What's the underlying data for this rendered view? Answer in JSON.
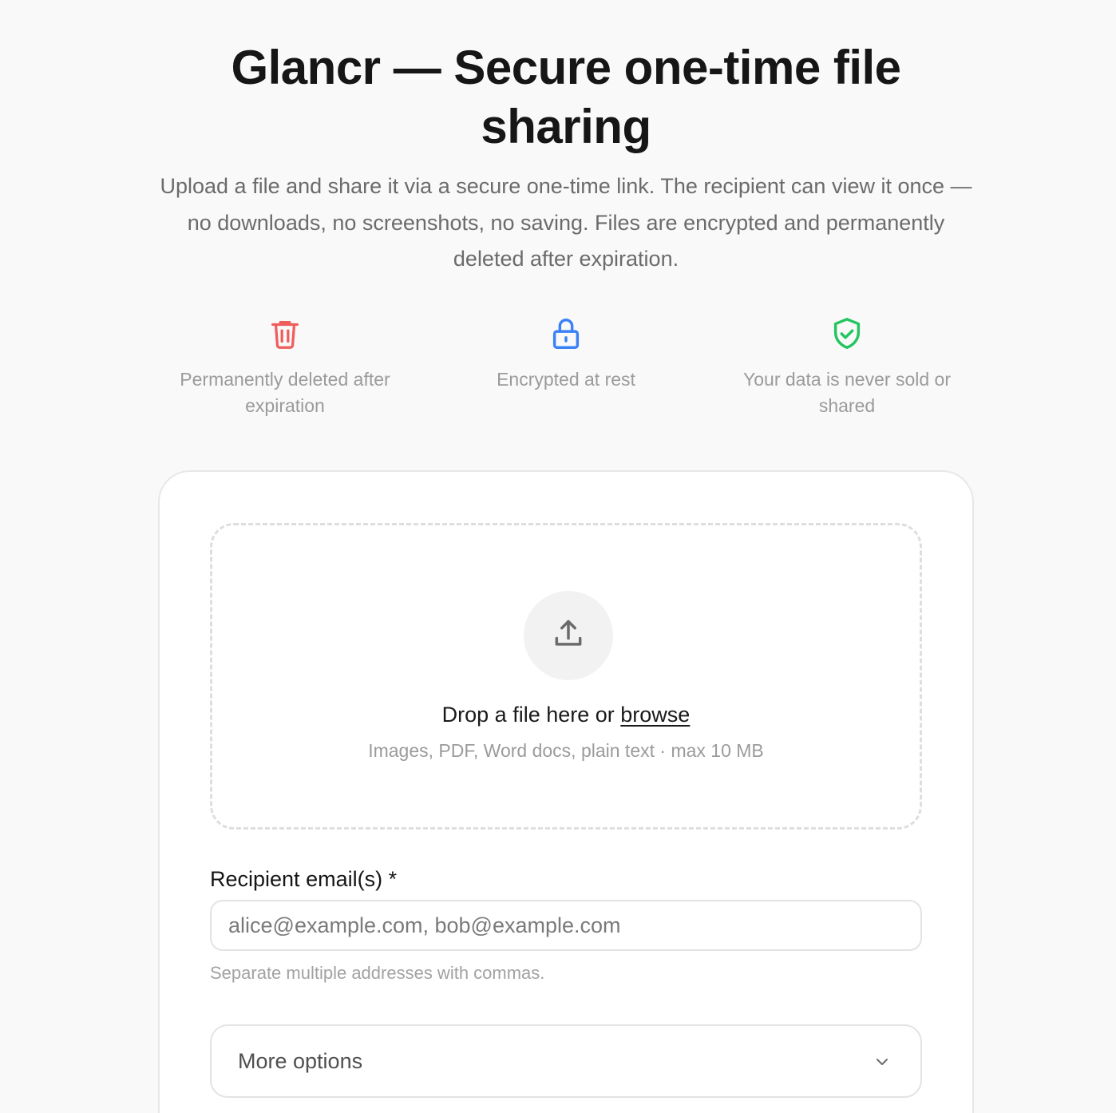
{
  "header": {
    "title": "Glancr — Secure one-time file sharing",
    "subtitle": "Upload a file and share it via a secure one-time link. The recipient can view it once — no downloads, no screenshots, no saving. Files are encrypted and permanently deleted after expiration."
  },
  "features": [
    {
      "icon": "trash-icon",
      "color": "#ef5d5d",
      "label": "Permanently deleted after expiration"
    },
    {
      "icon": "lock-icon",
      "color": "#3b82f6",
      "label": "Encrypted at rest"
    },
    {
      "icon": "shield-check-icon",
      "color": "#22c55e",
      "label": "Your data is never sold or shared"
    }
  ],
  "upload": {
    "icon": "upload-icon",
    "prompt": "Drop a file here or",
    "browse_label": "browse",
    "hint": "Images, PDF, Word docs, plain text · max 10 MB"
  },
  "recipient": {
    "label": "Recipient email(s) *",
    "placeholder": "alice@example.com, bob@example.com",
    "value": "",
    "help": "Separate multiple addresses with commas."
  },
  "more_options": {
    "label": "More options",
    "icon": "chevron-down-icon"
  }
}
